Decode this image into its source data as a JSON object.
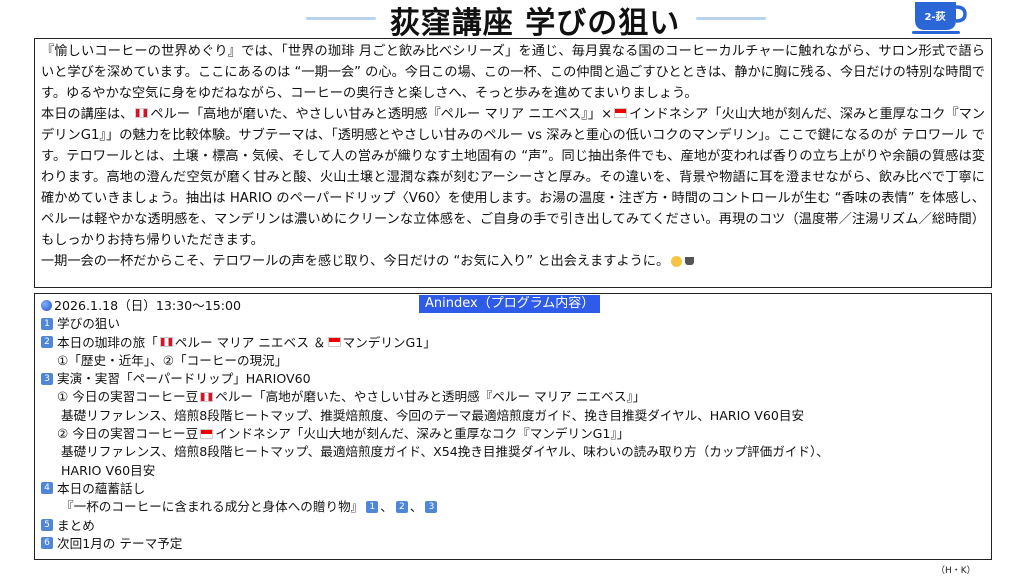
{
  "header": {
    "title": "荻窪講座 学びの狙い",
    "badge": "2-荻"
  },
  "intro": {
    "p1": "『愉しいコーヒーの世界めぐり』では、「世界の珈琲 月ごと飲み比べシリーズ」を通じ、毎月異なる国のコーヒーカルチャーに触れながら、サロン形式で語らいと学びを深めています。ここにあるのは “一期一会” の心。今日この場、この一杯、この仲間と過ごすひとときは、静かに胸に残る、今日だけの特別な時間です。ゆるやかな空気に身をゆだねながら、コーヒーの奥行きと楽しさへ、そっと歩みを進めてまいりましょう。",
    "p2a": "本日の講座は、",
    "p2b": "ペルー「高地が磨いた、やさしい甘みと透明感『ペルー マリア ニエベス』」×",
    "p2c": "インドネシア「火山大地が刻んだ、深みと重厚なコク『マンデリンG1』」の魅力を比較体験。サブテーマは、「透明感とやさしい甘みのペルー vs 深みと重心の低いコクのマンデリン」。ここで鍵になるのが テロワール です。テロワールとは、土壌・標高・気候、そして人の営みが織りなす土地固有の “声”。同じ抽出条件でも、産地が変われば香りの立ち上がりや余韻の質感は変わります。高地の澄んだ空気が磨く甘みと酸、火山土壌と湿潤な森が刻むアーシーさと厚み。その違いを、背景や物語に耳を澄ませながら、飲み比べで丁寧に確かめていきましょう。抽出は HARIO のペーパードリップ〈V60〉を使用します。お湯の温度・注ぎ方・時間のコントロールが生む “香味の表情” を体感し、ペルーは軽やかな透明感を、マンデリンは濃いめにクリーンな立体感を、ご自身の手で引き出してみてください。再現のコツ（温度帯／注湯リズム／総時間）もしっかりお持ち帰りいただきます。",
    "p3": "一期一会の一杯だからこそ、テロワールの声を感じ取り、今日だけの “お気に入り” と出会えますように。"
  },
  "program": {
    "label": "Anindex（プログラム内容）",
    "date": "2026.1.18（日）13:30～15:00",
    "n1": "1",
    "n2": "2",
    "n3": "3",
    "n4": "4",
    "n5": "5",
    "n6": "6",
    "s1": "学びの狙い",
    "s2a": "本日の珈琲の旅「",
    "s2b": "ペルー マリア ニエベス ＆",
    "s2c": "マンデリンG1」",
    "s2d": "①「歴史・近年」、②「コーヒーの現況」",
    "s3": "実演・実習「ペーパードリップ」HARIOV60",
    "s3a": "① 今日の実習コーヒー豆",
    "s3b": "ペルー「高地が磨いた、やさしい甘みと透明感『ペルー マリア ニエベス』」",
    "s3c": "基礎リファレンス、焙煎8段階ヒートマップ、推奨焙煎度、今回のテーマ最適焙煎度ガイド、挽き目推奨ダイヤル、HARIO V60目安",
    "s3d": "② 今日の実習コーヒー豆",
    "s3e": "インドネシア「火山大地が刻んだ、深みと重厚なコク『マンデリンG1』」",
    "s3f": "基礎リファレンス、焙煎8段階ヒートマップ、最適焙煎度ガイド、X54挽き目推奨ダイヤル、味わいの読み取り方（カップ評価ガイド）、",
    "s3g": "HARIO V60目安",
    "s4": "本日の蘊蓄話し",
    "s4a": "『一杯のコーヒーに含まれる成分と身体への贈り物』",
    "s4sep": "、",
    "s5": "まとめ",
    "s6": "次回1月の テーマ予定"
  },
  "footer": {
    "credit": "（H・K）"
  },
  "colors": {
    "accent": "#2f5bea",
    "number_box": "#4f86d8",
    "title_rule": "#b9d3ef"
  }
}
